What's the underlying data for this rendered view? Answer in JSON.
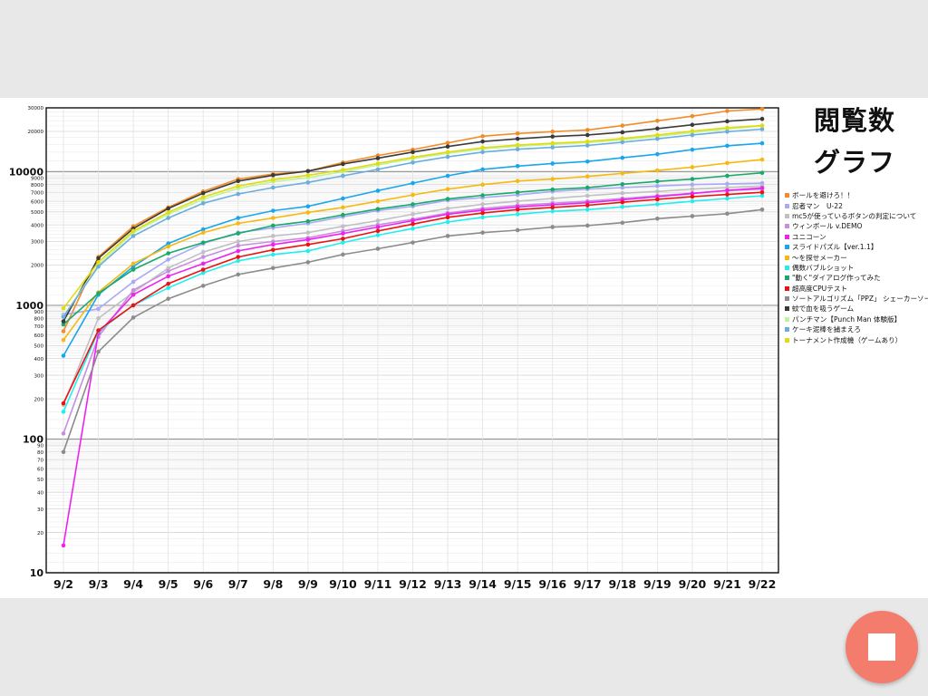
{
  "title": {
    "line1": "閲覧数",
    "line2": "グラフ"
  },
  "stop_button": {
    "icon": "stop-icon",
    "color": "#f47c6c"
  },
  "chart_data": {
    "type": "line",
    "scale": "log",
    "ylim": [
      10,
      30000
    ],
    "y_ticks": [
      {
        "value": 10,
        "label": "10",
        "major": true
      },
      {
        "value": 20,
        "label": "20"
      },
      {
        "value": 30,
        "label": "30"
      },
      {
        "value": 40,
        "label": "40"
      },
      {
        "value": 50,
        "label": "50"
      },
      {
        "value": 60,
        "label": "60"
      },
      {
        "value": 70,
        "label": "70"
      },
      {
        "value": 80,
        "label": "80"
      },
      {
        "value": 90,
        "label": "90"
      },
      {
        "value": 100,
        "label": "100",
        "major": true
      },
      {
        "value": 200,
        "label": "200"
      },
      {
        "value": 300,
        "label": "300"
      },
      {
        "value": 400,
        "label": "400"
      },
      {
        "value": 500,
        "label": "500"
      },
      {
        "value": 600,
        "label": "600"
      },
      {
        "value": 700,
        "label": "700"
      },
      {
        "value": 800,
        "label": "800"
      },
      {
        "value": 900,
        "label": "900"
      },
      {
        "value": 1000,
        "label": "1000",
        "major": true
      },
      {
        "value": 2000,
        "label": "2000"
      },
      {
        "value": 3000,
        "label": "3000"
      },
      {
        "value": 4000,
        "label": "4000"
      },
      {
        "value": 5000,
        "label": "5000"
      },
      {
        "value": 6000,
        "label": "6000"
      },
      {
        "value": 7000,
        "label": "7000"
      },
      {
        "value": 8000,
        "label": "8000"
      },
      {
        "value": 9000,
        "label": "9000"
      },
      {
        "value": 10000,
        "label": "10000",
        "major": true
      },
      {
        "value": 20000,
        "label": "20000"
      },
      {
        "value": 30000,
        "label": "30000"
      }
    ],
    "categories": [
      "9/2",
      "9/3",
      "9/4",
      "9/5",
      "9/6",
      "9/7",
      "9/8",
      "9/9",
      "9/10",
      "9/11",
      "9/12",
      "9/13",
      "9/14",
      "9/15",
      "9/16",
      "9/17",
      "9/18",
      "9/19",
      "9/20",
      "9/21",
      "9/22"
    ],
    "series": [
      {
        "name": "ボールを避けろ！！",
        "color": "#f28c28",
        "values": [
          640,
          2300,
          3900,
          5400,
          7100,
          8800,
          9600,
          10100,
          11700,
          13200,
          14600,
          16400,
          18400,
          19300,
          19900,
          20500,
          22100,
          24000,
          26000,
          28400,
          29400
        ]
      },
      {
        "name": "忍者マン　U-22",
        "color": "#a9a9f5",
        "values": [
          850,
          940,
          1500,
          2200,
          2900,
          3500,
          3800,
          4100,
          4600,
          5100,
          5500,
          6100,
          6400,
          6700,
          7100,
          7400,
          7600,
          7800,
          8000,
          8100,
          8200
        ]
      },
      {
        "name": "mc5が使っているボタンの判定について",
        "color": "#c0c0c0",
        "values": [
          180,
          800,
          1250,
          1900,
          2500,
          3000,
          3300,
          3500,
          3900,
          4300,
          4800,
          5300,
          5700,
          6000,
          6300,
          6600,
          6900,
          7100,
          7400,
          7600,
          7800
        ]
      },
      {
        "name": "ウィンボール v.DEMO",
        "color": "#c78ee0",
        "values": [
          110,
          580,
          1300,
          1800,
          2300,
          2800,
          3000,
          3200,
          3600,
          4000,
          4400,
          4900,
          5300,
          5600,
          5800,
          6000,
          6300,
          6600,
          6900,
          7200,
          7400
        ]
      },
      {
        "name": "ユニコーン",
        "color": "#ee22ee",
        "values": [
          16,
          620,
          1200,
          1650,
          2050,
          2550,
          2850,
          3100,
          3450,
          3850,
          4300,
          4800,
          5150,
          5450,
          5650,
          5850,
          6150,
          6500,
          6850,
          7250,
          7550
        ]
      },
      {
        "name": "スライドパズル【ver.1.1】",
        "color": "#19a6ec",
        "values": [
          420,
          1200,
          1950,
          2900,
          3700,
          4500,
          5100,
          5500,
          6300,
          7200,
          8200,
          9300,
          10400,
          11000,
          11500,
          11900,
          12700,
          13500,
          14600,
          15600,
          16300
        ]
      },
      {
        "name": "〜を探せメーカー",
        "color": "#f5b90f",
        "values": [
          550,
          1250,
          2050,
          2750,
          3500,
          4100,
          4500,
          4950,
          5400,
          6000,
          6700,
          7400,
          8000,
          8500,
          8800,
          9200,
          9700,
          10200,
          10800,
          11600,
          12300
        ]
      },
      {
        "name": "偶数バブルショット",
        "color": "#22eeee",
        "values": [
          160,
          640,
          1000,
          1350,
          1750,
          2150,
          2400,
          2550,
          2950,
          3350,
          3750,
          4200,
          4550,
          4800,
          5050,
          5200,
          5450,
          5700,
          6000,
          6300,
          6600
        ]
      },
      {
        "name": "\"動く\"ダイアログ作ってみた",
        "color": "#19a96a",
        "values": [
          720,
          1230,
          1850,
          2450,
          2950,
          3450,
          3950,
          4250,
          4750,
          5250,
          5700,
          6250,
          6650,
          7000,
          7350,
          7600,
          8050,
          8450,
          8800,
          9300,
          9800
        ]
      },
      {
        "name": "超高度CPUテスト",
        "color": "#ee1111",
        "values": [
          185,
          650,
          1000,
          1450,
          1850,
          2300,
          2600,
          2850,
          3150,
          3600,
          4050,
          4550,
          4900,
          5200,
          5400,
          5600,
          5900,
          6200,
          6500,
          6750,
          7000
        ]
      },
      {
        "name": "ソートアルゴリズム「PPZ」 シェーカーソート",
        "color": "#8c8c8c",
        "values": [
          80,
          450,
          810,
          1120,
          1400,
          1700,
          1900,
          2100,
          2400,
          2650,
          2950,
          3300,
          3500,
          3650,
          3850,
          3950,
          4150,
          4450,
          4650,
          4850,
          5200
        ]
      },
      {
        "name": "蚊で血を吸うゲーム",
        "color": "#3a3a3a",
        "values": [
          760,
          2250,
          3750,
          5300,
          6900,
          8500,
          9400,
          10100,
          11400,
          12600,
          14000,
          15400,
          16800,
          17600,
          18300,
          18800,
          19700,
          21000,
          22400,
          23800,
          24800
        ]
      },
      {
        "name": "パンチマン【Punch Man 体験版】",
        "color": "#c2f29a",
        "values": [
          830,
          2000,
          3500,
          4800,
          6200,
          7500,
          8400,
          9000,
          10000,
          11200,
          12500,
          13700,
          14800,
          15500,
          16000,
          16500,
          17300,
          18400,
          19600,
          20800,
          22000
        ]
      },
      {
        "name": "ケーキ泥棒を捕まえろ",
        "color": "#6aaee0",
        "values": [
          820,
          1950,
          3300,
          4500,
          5800,
          6800,
          7600,
          8300,
          9300,
          10400,
          11700,
          12900,
          14000,
          14700,
          15200,
          15700,
          16600,
          17600,
          18800,
          19900,
          20800
        ]
      },
      {
        "name": "トーナメント作成機（ゲームあり）",
        "color": "#e0dc10",
        "values": [
          950,
          2100,
          3600,
          4950,
          6450,
          7800,
          8700,
          9400,
          10300,
          11500,
          12800,
          14000,
          15100,
          15800,
          16300,
          16800,
          17700,
          18800,
          20100,
          21300,
          22100
        ]
      }
    ]
  }
}
